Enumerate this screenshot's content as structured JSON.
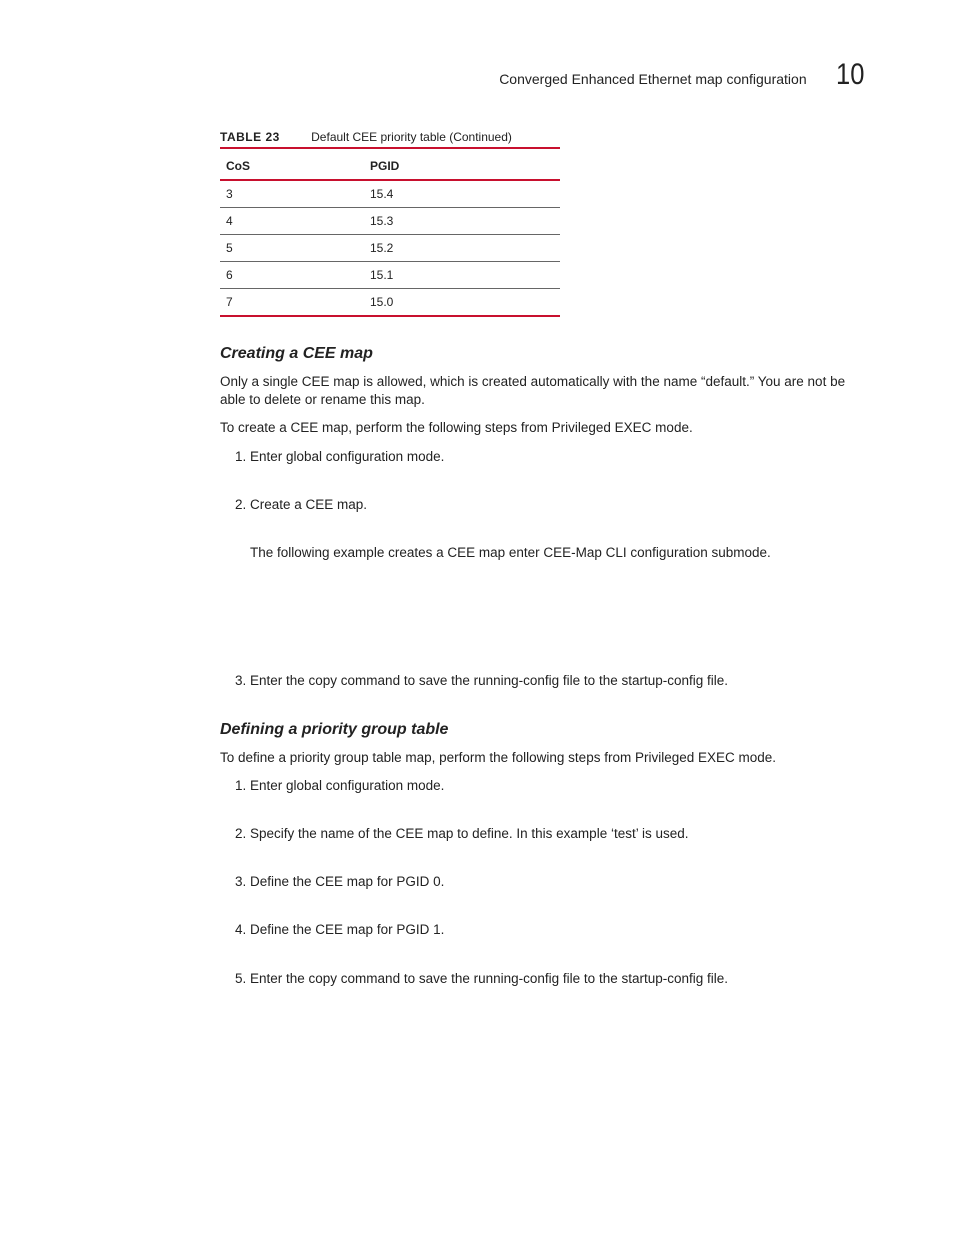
{
  "header": {
    "title": "Converged Enhanced Ethernet map configuration",
    "chapter": "10"
  },
  "table": {
    "label": "TABLE 23",
    "caption": "Default CEE priority table  (Continued)",
    "headers": {
      "cos": "CoS",
      "pgid": "PGID"
    },
    "rows": [
      {
        "cos": "3",
        "pgid": "15.4"
      },
      {
        "cos": "4",
        "pgid": "15.3"
      },
      {
        "cos": "5",
        "pgid": "15.2"
      },
      {
        "cos": "6",
        "pgid": "15.1"
      },
      {
        "cos": "7",
        "pgid": "15.0"
      }
    ]
  },
  "section1": {
    "heading": "Creating a CEE map",
    "p1": "Only a single CEE map is allowed, which is created automatically with the name “default.” You are not be able to delete or rename this map.",
    "p2": "To create a CEE map, perform the following steps from Privileged EXEC mode.",
    "steps": {
      "s1": "Enter global configuration mode.",
      "s2": "Create a CEE map.",
      "s2sub": "The following example creates a CEE map enter CEE-Map CLI configuration submode.",
      "s3": "Enter the copy command to save the running-config file to the startup-config file."
    }
  },
  "section2": {
    "heading": "Defining a priority group table",
    "p1": "To define a priority group table map, perform the following steps from Privileged EXEC mode.",
    "steps": {
      "s1": "Enter global configuration mode.",
      "s2": "Specify the name of the CEE map to define. In this example ‘test’ is used.",
      "s3": "Define the CEE map for PGID 0.",
      "s4": "Define the CEE map for PGID 1.",
      "s5": "Enter the copy command to save the running-config file to the startup-config file."
    }
  }
}
